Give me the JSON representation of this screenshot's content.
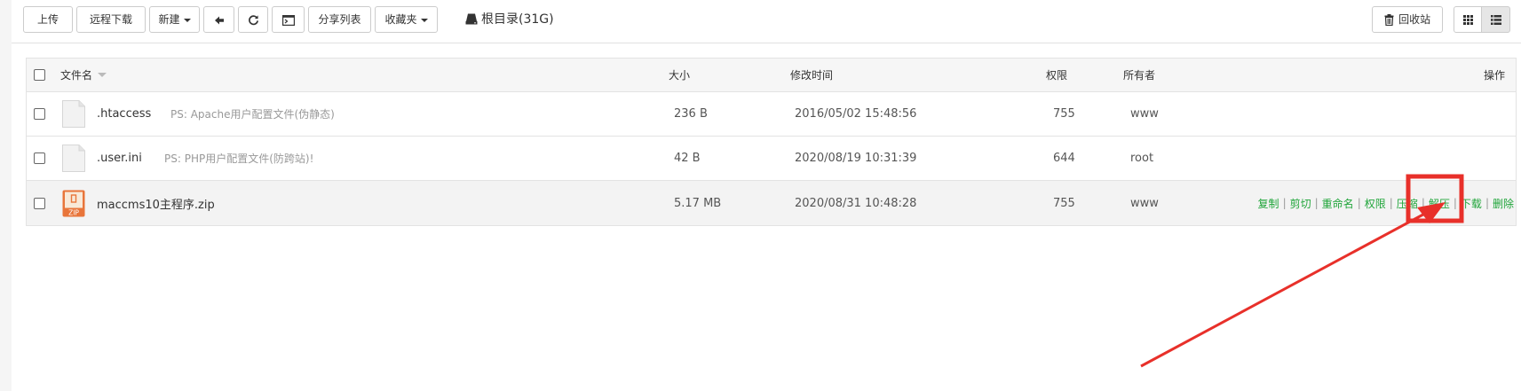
{
  "toolbar": {
    "upload": "上传",
    "remote_download": "远程下载",
    "new": "新建",
    "share_list": "分享列表",
    "favorites": "收藏夹",
    "path": "根目录(31G)",
    "recycle_bin": "回收站"
  },
  "table": {
    "headers": {
      "name": "文件名",
      "size": "大小",
      "modified": "修改时间",
      "permission": "权限",
      "owner": "所有者",
      "actions": "操作"
    },
    "rows": [
      {
        "name": ".htaccess",
        "desc": "PS: Apache用户配置文件(伪静态)",
        "size": "236 B",
        "modified": "2016/05/02 15:48:56",
        "permission": "755",
        "owner": "www",
        "icon": "file-icon"
      },
      {
        "name": ".user.ini",
        "desc": "PS: PHP用户配置文件(防跨站)!",
        "size": "42 B",
        "modified": "2020/08/19 10:31:39",
        "permission": "644",
        "owner": "root",
        "icon": "file-icon"
      },
      {
        "name": "maccms10主程序.zip",
        "desc": "",
        "size": "5.17 MB",
        "modified": "2020/08/31 10:48:28",
        "permission": "755",
        "owner": "www",
        "icon": "zip-icon",
        "zip_label": "ZIP"
      }
    ],
    "actions": [
      "复制",
      "剪切",
      "重命名",
      "权限",
      "压缩",
      "解压",
      "下载",
      "删除"
    ]
  },
  "colors": {
    "action_link": "#20a53a",
    "annotation": "#e8302a"
  }
}
